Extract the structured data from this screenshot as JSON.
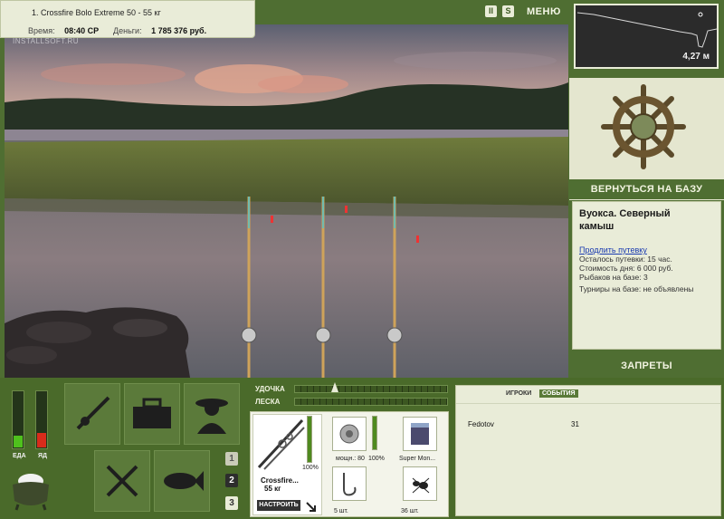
{
  "info": {
    "rod_line": "1. Crossfire Bolo Extreme 50 - 55 кг",
    "time_label": "Время:",
    "time_value": "08:40 СР",
    "money_label": "Деньги:",
    "money_value": "1 785 376 руб."
  },
  "controls": {
    "pause": "II",
    "sound": "S",
    "menu": "МЕНЮ"
  },
  "watermark": "INSTALLSOFT.RU",
  "depth": {
    "value": "4,27 м"
  },
  "base": {
    "return_label": "ВЕРНУТЬСЯ НА БАЗУ",
    "location_title": "Вуокса. Северный камыш",
    "extend_link": "Продлить путевку",
    "lines": [
      "Осталось путевки: 15 час.",
      "Стоимость дня: 6 000 руб.",
      "Рыбаков на базе: 3",
      "Турниры на базе: не объявлены"
    ],
    "bans_label": "ЗАПРЕТЫ"
  },
  "meters": {
    "food_label": "ЕДА",
    "food_level": 0.2,
    "food_color": "#4fc11d",
    "poison_label": "ЯД",
    "poison_level": 0.25,
    "poison_color": "#d92b1b"
  },
  "tiles": [
    "rod-tile",
    "tackle-box-tile",
    "fisherman-tile",
    "food-tile",
    "fish-tile"
  ],
  "slots_buttons": [
    "1",
    "2",
    "3"
  ],
  "bars": {
    "rod_label": "УДОЧКА",
    "line_label": "ЛЕСКА",
    "rod_marker": 0.24
  },
  "tackle": {
    "rod_name": "Crossfire...",
    "rod_weight": "55 кг",
    "rod_percent": "100%",
    "reel_caption": "мощн.: 80",
    "reel_percent": "100%",
    "line_caption": "Super Mon...",
    "hook_caption": "5 шт.",
    "bait_caption": "36 шт.",
    "setup_label": "НАСТРОИТЬ"
  },
  "players": {
    "tab_players": "ИГРОКИ",
    "tab_events": "СОБЫТИЯ",
    "rows": [
      {
        "name": "Fedotov",
        "value": "31"
      }
    ]
  }
}
